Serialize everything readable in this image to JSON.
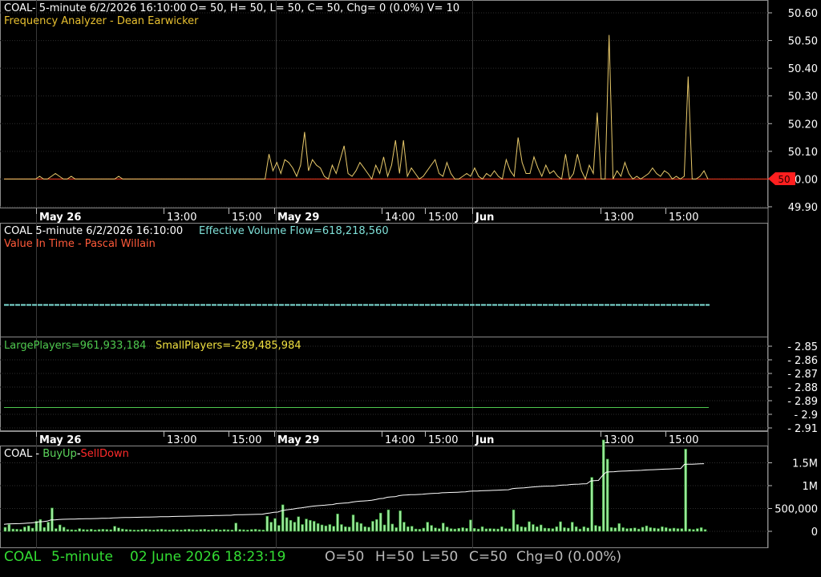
{
  "panel1": {
    "header": "COAL- 5-minute 6/2/2026 16:10:00 O= 50, H= 50, L= 50, C= 50, Chg= 0 (0.0%) V= 10",
    "subtitle": "Frequency Analyzer - Dean Earwicker",
    "price_marker": "50"
  },
  "date_axis": {
    "labels": [
      "May 26",
      "13:00",
      "15:00",
      "May 29",
      "14:00",
      "15:00",
      "Jun",
      "13:00",
      "15:00"
    ]
  },
  "panel2": {
    "header_left": "COAL 5-minute  6/2/2026 16:10:00",
    "header_right": "Effective Volume Flow=618,218,560",
    "subtitle": "Value In Time - Pascal Willain"
  },
  "panel3": {
    "large_players": "LargePlayers=961,933,184",
    "small_players": "SmallPlayers=-289,485,984"
  },
  "panel4": {
    "label_symbol": "COAL - ",
    "label_buy": "BuyUp",
    "label_dash": "-",
    "label_sell": "SellDown"
  },
  "status": {
    "symbol": "COAL",
    "interval": "5-minute",
    "datetime": "02 June 2026 18:23:19",
    "open": "O=50",
    "high": "H=50",
    "low": "L=50",
    "close": "C=50",
    "change": "Chg=0 (0.00%)"
  },
  "colors": {
    "background": "#000000",
    "grid": "#3a3a3a",
    "price_line": "#e8c96a",
    "baseline": "#ff3b1f",
    "marker": "#ff1f1f",
    "evf": "#7fe0d8",
    "large_players": "#4ec84e",
    "small_players": "#f0e040",
    "buyup": "#5cd65c",
    "selldown": "#ff2a2a",
    "status_green": "#33dd33"
  },
  "chart_data": [
    {
      "type": "line",
      "title": "Frequency Analyzer - Dean Earwicker",
      "series": [
        {
          "values": [
            50.0,
            50.0,
            50.0,
            50.0,
            50.0,
            50.0,
            50.0,
            50.0,
            50.0,
            50.01,
            50.0,
            50.0,
            50.01,
            50.02,
            50.01,
            50.0,
            50.0,
            50.01,
            50.0,
            50.0,
            50.0,
            50.0,
            50.0,
            50.0,
            50.0,
            50.0,
            50.0,
            50.0,
            50.0,
            50.01,
            50.0,
            50.0,
            50.0,
            50.0,
            50.0,
            50.0,
            50.0,
            50.0,
            50.0,
            50.0,
            50.0,
            50.0,
            50.0,
            50.0,
            50.0,
            50.0,
            50.0,
            50.0,
            50.0,
            50.0,
            50.0,
            50.0,
            50.0,
            50.0,
            50.0,
            50.0,
            50.0,
            50.0,
            50.0,
            50.0,
            50.0,
            50.0,
            50.0,
            50.0,
            50.0,
            50.0,
            50.0,
            50.09,
            50.03,
            50.06,
            50.02,
            50.07,
            50.06,
            50.04,
            50.01,
            50.05,
            50.17,
            50.03,
            50.07,
            50.05,
            50.04,
            50.01,
            50.0,
            50.05,
            50.02,
            50.07,
            50.12,
            50.02,
            50.01,
            50.03,
            50.06,
            50.04,
            50.02,
            50.0,
            50.05,
            50.02,
            50.08,
            50.01,
            50.05,
            50.14,
            50.02,
            50.14,
            50.01,
            50.04,
            50.02,
            50.0,
            50.01,
            50.03,
            50.05,
            50.07,
            50.02,
            50.01,
            50.06,
            50.02,
            50.0,
            50.0,
            50.01,
            50.02,
            50.01,
            50.04,
            50.01,
            50.0,
            50.02,
            50.01,
            50.03,
            50.01,
            50.0,
            50.07,
            50.03,
            50.01,
            50.15,
            50.06,
            50.02,
            50.02,
            50.08,
            50.04,
            50.01,
            50.05,
            50.02,
            50.03,
            50.01,
            50.0,
            50.09,
            50.0,
            50.02,
            50.09,
            50.03,
            50.0,
            50.05,
            50.02,
            50.24,
            50.0,
            50.0,
            50.52,
            50.0,
            50.03,
            50.01,
            50.06,
            50.02,
            50.0,
            50.01,
            50.0,
            50.01,
            50.02,
            50.04,
            50.02,
            50.01,
            50.03,
            50.02,
            50.0,
            50.01,
            50.0,
            50.01,
            50.37,
            50.0,
            50.0,
            50.01,
            50.03,
            50.0
          ]
        },
        {
          "values": [
            50.0,
            50.0
          ]
        }
      ],
      "ylim": [
        49.9,
        50.6
      ],
      "yticks": [
        "50.60",
        "50.50",
        "50.40",
        "50.30",
        "50.20",
        "50.10",
        "50.00",
        "49.90"
      ]
    },
    {
      "type": "line",
      "title": "Value In Time - Pascal Willain",
      "series": [
        {
          "values": [
            618218560,
            618218560
          ]
        }
      ]
    },
    {
      "type": "line",
      "series": [
        {
          "name": "LargePlayers",
          "values": [
            961933184,
            961933184
          ]
        },
        {
          "name": "SmallPlayers",
          "values": [
            -289485984,
            -289485984
          ]
        }
      ],
      "ylim": [
        -2.915,
        -2.845
      ],
      "yticks": [
        "- 2.85",
        "- 2.86",
        "- 2.87",
        "- 2.88",
        "- 2.89",
        "- 2.9",
        "- 2.91"
      ]
    },
    {
      "type": "bar",
      "series": [
        {
          "values": [
            88000,
            150000,
            50000,
            45000,
            40000,
            95000,
            120000,
            70000,
            220000,
            260000,
            85000,
            200000,
            510000,
            60000,
            140000,
            90000,
            40000,
            35000,
            30000,
            60000,
            40000,
            35000,
            45000,
            30000,
            40000,
            45000,
            40000,
            35000,
            110000,
            75000,
            50000,
            40000,
            35000,
            30000,
            30000,
            40000,
            45000,
            35000,
            30000,
            40000,
            45000,
            35000,
            30000,
            40000,
            35000,
            30000,
            40000,
            45000,
            35000,
            30000,
            40000,
            45000,
            30000,
            35000,
            45000,
            30000,
            40000,
            35000,
            30000,
            180000,
            40000,
            35000,
            30000,
            40000,
            45000,
            35000,
            30000,
            330000,
            200000,
            280000,
            130000,
            580000,
            300000,
            240000,
            200000,
            320000,
            150000,
            270000,
            240000,
            220000,
            170000,
            140000,
            120000,
            150000,
            110000,
            380000,
            150000,
            100000,
            95000,
            360000,
            200000,
            170000,
            100000,
            90000,
            220000,
            260000,
            400000,
            140000,
            470000,
            160000,
            80000,
            450000,
            200000,
            100000,
            110000,
            50000,
            45000,
            70000,
            200000,
            130000,
            75000,
            60000,
            180000,
            95000,
            60000,
            50000,
            65000,
            80000,
            65000,
            250000,
            65000,
            50000,
            100000,
            55000,
            60000,
            55000,
            50000,
            100000,
            60000,
            55000,
            470000,
            150000,
            100000,
            90000,
            210000,
            150000,
            100000,
            140000,
            70000,
            65000,
            60000,
            100000,
            210000,
            80000,
            70000,
            200000,
            100000,
            50000,
            100000,
            75000,
            1180000,
            130000,
            110000,
            2000000,
            1580000,
            85000,
            75000,
            170000,
            80000,
            60000,
            65000,
            75000,
            50000,
            90000,
            120000,
            80000,
            70000,
            60000,
            100000,
            80000,
            60000,
            70000,
            60000,
            60000,
            1800000,
            50000,
            40000,
            60000,
            80000,
            40000
          ]
        },
        {
          "values": [
            0,
            0
          ]
        },
        {
          "values": [
            150000,
            1450000,
            1480000
          ]
        }
      ],
      "yticks": [
        "1.5M",
        "1M",
        "500,000",
        "0"
      ]
    }
  ]
}
